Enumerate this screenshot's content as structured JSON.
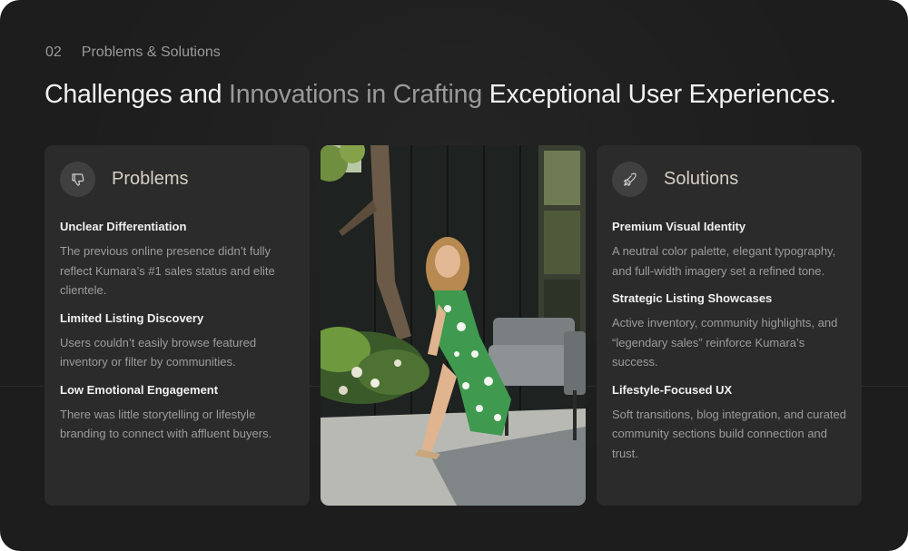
{
  "section": {
    "number": "02",
    "label": "Problems & Solutions"
  },
  "headline": {
    "part1": "Challenges and ",
    "part2": "Innovations in Crafting",
    "part3": " Exceptional User Experiences."
  },
  "problems": {
    "title": "Problems",
    "icon": "thumbs-down-icon",
    "items": [
      {
        "title": "Unclear Differentiation",
        "text": "The previous online presence didn’t fully reflect Kumara’s #1 sales status and elite clientele."
      },
      {
        "title": "Limited Listing Discovery",
        "text": "Users couldn’t easily browse featured inventory or filter by communities."
      },
      {
        "title": "Low Emotional Engagement",
        "text": "There was little storytelling or lifestyle branding to connect with affluent buyers."
      }
    ]
  },
  "solutions": {
    "title": "Solutions",
    "icon": "rocket-icon",
    "items": [
      {
        "title": "Premium Visual Identity",
        "text": "A neutral color palette, elegant typography, and full-width imagery set a refined tone."
      },
      {
        "title": "Strategic Listing Showcases",
        "text": "Active inventory, community highlights, and “legendary sales” reinforce Kumara’s success."
      },
      {
        "title": "Lifestyle-Focused UX",
        "text": "Soft transitions, blog integration, and curated community sections build connection and trust."
      }
    ]
  },
  "colors": {
    "background": "#1d1d1d",
    "card": "#2b2b2b",
    "accent_text": "#d6d0c4"
  }
}
